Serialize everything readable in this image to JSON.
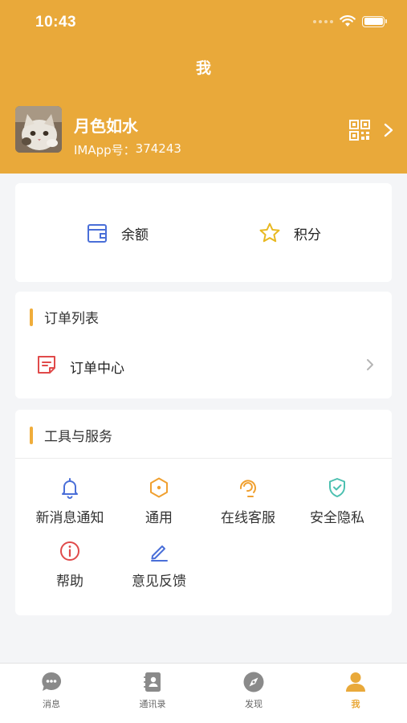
{
  "status_bar": {
    "time": "10:43"
  },
  "header": {
    "title": "我",
    "profile": {
      "name": "月色如水",
      "id_label": "IMApp号：",
      "id_value": "374243"
    }
  },
  "wallet": {
    "items": [
      {
        "label": "余额",
        "icon": "wallet-icon",
        "color": "#4a6fd8"
      },
      {
        "label": "积分",
        "icon": "star-icon",
        "color": "#e8b820"
      }
    ]
  },
  "orders": {
    "section_title": "订单列表",
    "item": {
      "label": "订单中心",
      "icon": "order-note-icon",
      "color": "#e04a4a"
    }
  },
  "tools": {
    "section_title": "工具与服务",
    "items": [
      {
        "label": "新消息通知",
        "icon": "bell-icon",
        "color": "#4a6fd8"
      },
      {
        "label": "通用",
        "icon": "hexagon-icon",
        "color": "#f0a030"
      },
      {
        "label": "在线客服",
        "icon": "headset-icon",
        "color": "#f0a030"
      },
      {
        "label": "安全隐私",
        "icon": "shield-icon",
        "color": "#4cc0b0"
      },
      {
        "label": "帮助",
        "icon": "info-icon",
        "color": "#e04a4a"
      },
      {
        "label": "意见反馈",
        "icon": "pencil-icon",
        "color": "#4a6fd8"
      }
    ]
  },
  "tabbar": {
    "tabs": [
      {
        "label": "消息",
        "icon": "chat-icon",
        "active": false
      },
      {
        "label": "通讯录",
        "icon": "contacts-icon",
        "active": false
      },
      {
        "label": "发现",
        "icon": "compass-icon",
        "active": false
      },
      {
        "label": "我",
        "icon": "person-icon",
        "active": true
      }
    ]
  },
  "colors": {
    "brand": "#e9a93a",
    "section_accent": "#f0ad3b",
    "tab_inactive": "#8a8a8a"
  }
}
